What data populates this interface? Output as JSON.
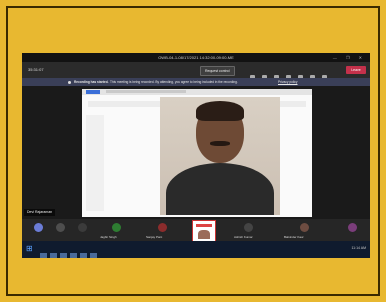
{
  "window": {
    "title": "OWB-04-1-08/17/2021 14:32:00-09:00-ME",
    "controls": "— ❐ ✕"
  },
  "toolbar": {
    "timer": "35:31:07",
    "request_control_label": "Request control",
    "leave_label": "Leave"
  },
  "recording_banner": {
    "title": "Recording has started.",
    "message": "This meeting is being recorded. By attending, you agree to being included in the recording.",
    "link": "Privacy policy"
  },
  "stage": {
    "presenter_name": "Devi Rajaraman"
  },
  "participants": [
    {
      "name": "Jagbir Singh",
      "color": "#6b7cd6"
    },
    {
      "name": "Sanjay Pant",
      "color": "#4e4e4e"
    },
    {
      "name": "Ashish Kumar",
      "color": "#3b3b3b"
    },
    {
      "name": "Balvinder Kaur",
      "color": "#2e7d32"
    },
    {
      "name": "Tara Devi",
      "color": "#8b2c2c"
    },
    {
      "name": "Meena Kumari",
      "color": "#444"
    },
    {
      "name": "Sunil Kumar",
      "color": "#6d4c41"
    },
    {
      "name": "Neha Kaur",
      "color": "#7a3d7a"
    }
  ],
  "taskbar": {
    "start_icon": "windows-logo-icon",
    "tray_time": "11:14 AM"
  },
  "colors": {
    "background": "#e8b830",
    "leave": "#c4314b",
    "banner": "#3a3f58"
  }
}
